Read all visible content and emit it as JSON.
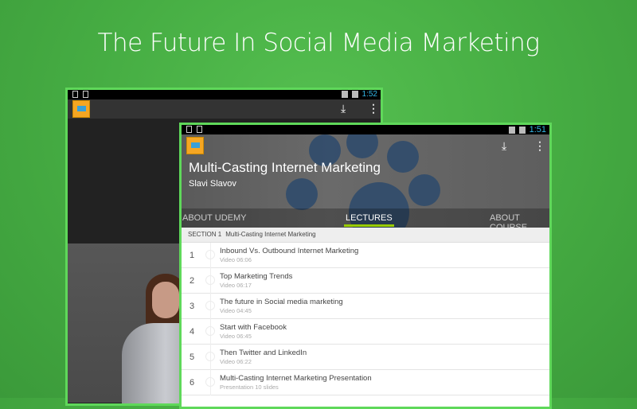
{
  "headline": "The Future In Social Media Marketing",
  "back_screen": {
    "time": "1:52"
  },
  "front_screen": {
    "time": "1:51",
    "course_title": "Multi-Casting Internet Marketing",
    "author": "Slavi Slavov",
    "tabs": [
      "ABOUT UDEMY",
      "LECTURES",
      "ABOUT COURSE"
    ],
    "active_tab": "LECTURES",
    "section": {
      "label": "SECTION 1",
      "title": "Multi-Casting Internet Marketing"
    },
    "lectures": [
      {
        "num": "1",
        "title": "Inbound Vs. Outbound Internet Marketing",
        "sub": "Video 06:06"
      },
      {
        "num": "2",
        "title": "Top Marketing Trends",
        "sub": "Video 06:17"
      },
      {
        "num": "3",
        "title": "The future in Social media marketing",
        "sub": "Video 04:45"
      },
      {
        "num": "4",
        "title": "Start with Facebook",
        "sub": "Video 06:45"
      },
      {
        "num": "5",
        "title": "Then Twitter and LinkedIn",
        "sub": "Video 06:22"
      },
      {
        "num": "6",
        "title": "Multi-Casting Internet Marketing Presentation",
        "sub": "Presentation 10 slides"
      }
    ]
  },
  "colors": {
    "accent": "#99cc00",
    "frame": "#5fd85a",
    "status_blue": "#33b5e5"
  }
}
